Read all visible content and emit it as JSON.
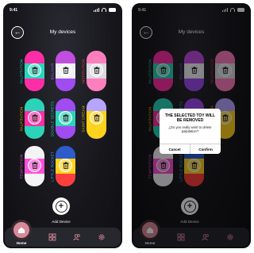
{
  "status": {
    "time": "9:41"
  },
  "header": {
    "title": "My devices"
  },
  "devices": [
    {
      "name": "PALPITATION",
      "label_color": "#27c7b0",
      "top": "#ff2ea6",
      "band": "#2bd4b8",
      "bottom": "#ff2ea6"
    },
    {
      "name": "BOLIVAR",
      "label_color": "#a35be8",
      "top": "#c24ee0",
      "band": "#eef0f4",
      "bottom": "#a04cf0"
    },
    {
      "name": "INSPIRATION",
      "label_color": "#d6454f",
      "top": "#ff7fbd",
      "band": "#d9d9de",
      "bottom": "#ff7fbd"
    },
    {
      "name": "PALPITATION",
      "label_color": "#d9b400",
      "top": "#2bd4b8",
      "band": "#ff2ea6",
      "bottom": "#2bd4b8"
    },
    {
      "name": "DOUBLE SECRETS",
      "label_color": "#27c7b0",
      "top": "#a04cf0",
      "band": "#2bd4b8",
      "bottom": "#a04cf0"
    },
    {
      "name": "SAINT DREAM",
      "label_color": "#d9b400",
      "top": "#b6a6ff",
      "band": "#ffd21c",
      "bottom": "#ffd21c"
    },
    {
      "name": "TEMPTATION",
      "label_color": "#d64fd0",
      "top": "#f4f4f6",
      "band": "#ff4fd8",
      "bottom": "#f4f4f6"
    },
    {
      "name": "LITTLE ROCKET",
      "label_color": "#3aa5ff",
      "top": "#2f5cc9",
      "band": "#ffd21c",
      "bottom": "#ff3f3f"
    }
  ],
  "add_device": {
    "label": "Add Device"
  },
  "tabbar": {
    "home_label": "Home"
  },
  "dialog": {
    "title": "THE SELECTED TOY WILL BE REMOVED",
    "message": "¿Do you really want to delete palpitation?",
    "cancel": "Cancel",
    "confirm": "Confirm"
  }
}
